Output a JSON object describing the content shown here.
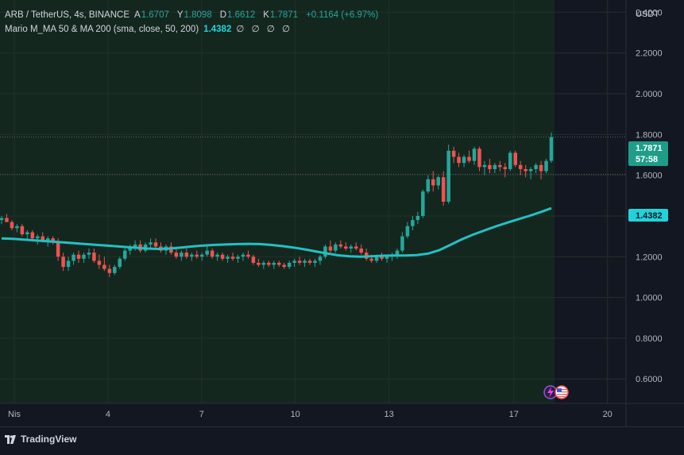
{
  "legend": {
    "symbol": "ARB / TetherUS, 4s, BINANCE",
    "open_label": "A",
    "open": "1.6707",
    "high_label": "Y",
    "high": "1.8098",
    "low_label": "D",
    "low": "1.6612",
    "close_label": "K",
    "close": "1.7871",
    "change": "+0.1164 (+6.97%)",
    "indicator_name": "Mario M_MA 50 & MA 200 (sma, close, 50, 200)",
    "indicator_value": "1.4382",
    "indicator_extra": "∅ ∅ ∅ ∅"
  },
  "axis": {
    "currency": "USDT",
    "price_badge": "1.7871",
    "countdown": "57:58",
    "ma_badge": "1.4382"
  },
  "footer": {
    "brand": "TradingView",
    "logo_icon": "tradingview-logo-icon"
  },
  "colors": {
    "up": "#26a69a",
    "down": "#ef5350",
    "ma": "#22c1c3",
    "plot_bg": "#14271f",
    "future_bg": "#131722"
  },
  "chart_data": {
    "type": "candlestick",
    "yticks": [
      "2.4000",
      "2.2000",
      "2.0000",
      "1.8000",
      "1.6000",
      "1.4000",
      "1.2000",
      "1.0000",
      "0.8000",
      "0.6000"
    ],
    "ylim": [
      0.48,
      2.46
    ],
    "xticks": [
      {
        "label": "Nis",
        "day": 1
      },
      {
        "label": "4",
        "day": 4
      },
      {
        "label": "7",
        "day": 7
      },
      {
        "label": "10",
        "day": 10
      },
      {
        "label": "13",
        "day": 13
      },
      {
        "label": "17",
        "day": 17
      },
      {
        "label": "20",
        "day": 20
      }
    ],
    "grid": true,
    "current_price": 1.7871,
    "reference_line": 1.605,
    "candles": [
      [
        1.38,
        1.4,
        1.36,
        1.39
      ],
      [
        1.39,
        1.41,
        1.37,
        1.37
      ],
      [
        1.37,
        1.38,
        1.33,
        1.34
      ],
      [
        1.34,
        1.36,
        1.32,
        1.35
      ],
      [
        1.35,
        1.36,
        1.3,
        1.31
      ],
      [
        1.31,
        1.33,
        1.28,
        1.32
      ],
      [
        1.32,
        1.33,
        1.28,
        1.29
      ],
      [
        1.29,
        1.31,
        1.26,
        1.3
      ],
      [
        1.3,
        1.32,
        1.27,
        1.28
      ],
      [
        1.28,
        1.3,
        1.25,
        1.29
      ],
      [
        1.29,
        1.3,
        1.26,
        1.27
      ],
      [
        1.27,
        1.29,
        1.18,
        1.2
      ],
      [
        1.2,
        1.22,
        1.13,
        1.15
      ],
      [
        1.15,
        1.2,
        1.13,
        1.18
      ],
      [
        1.18,
        1.22,
        1.16,
        1.21
      ],
      [
        1.21,
        1.23,
        1.17,
        1.19
      ],
      [
        1.19,
        1.22,
        1.17,
        1.21
      ],
      [
        1.21,
        1.24,
        1.19,
        1.22
      ],
      [
        1.22,
        1.24,
        1.17,
        1.18
      ],
      [
        1.18,
        1.21,
        1.14,
        1.16
      ],
      [
        1.16,
        1.2,
        1.13,
        1.14
      ],
      [
        1.14,
        1.16,
        1.1,
        1.12
      ],
      [
        1.12,
        1.16,
        1.11,
        1.15
      ],
      [
        1.15,
        1.2,
        1.14,
        1.19
      ],
      [
        1.19,
        1.24,
        1.18,
        1.23
      ],
      [
        1.23,
        1.26,
        1.21,
        1.25
      ],
      [
        1.25,
        1.28,
        1.23,
        1.26
      ],
      [
        1.26,
        1.28,
        1.22,
        1.23
      ],
      [
        1.23,
        1.27,
        1.22,
        1.26
      ],
      [
        1.26,
        1.29,
        1.24,
        1.27
      ],
      [
        1.27,
        1.29,
        1.24,
        1.25
      ],
      [
        1.25,
        1.27,
        1.22,
        1.23
      ],
      [
        1.23,
        1.26,
        1.21,
        1.25
      ],
      [
        1.25,
        1.27,
        1.21,
        1.22
      ],
      [
        1.22,
        1.24,
        1.19,
        1.2
      ],
      [
        1.2,
        1.23,
        1.18,
        1.22
      ],
      [
        1.22,
        1.24,
        1.19,
        1.2
      ],
      [
        1.2,
        1.22,
        1.18,
        1.21
      ],
      [
        1.21,
        1.23,
        1.19,
        1.2
      ],
      [
        1.2,
        1.22,
        1.18,
        1.21
      ],
      [
        1.21,
        1.25,
        1.2,
        1.23
      ],
      [
        1.23,
        1.24,
        1.19,
        1.2
      ],
      [
        1.2,
        1.22,
        1.18,
        1.21
      ],
      [
        1.21,
        1.22,
        1.18,
        1.19
      ],
      [
        1.19,
        1.21,
        1.17,
        1.2
      ],
      [
        1.2,
        1.22,
        1.18,
        1.19
      ],
      [
        1.19,
        1.21,
        1.17,
        1.2
      ],
      [
        1.2,
        1.22,
        1.18,
        1.21
      ],
      [
        1.21,
        1.23,
        1.19,
        1.2
      ],
      [
        1.2,
        1.21,
        1.16,
        1.17
      ],
      [
        1.17,
        1.19,
        1.15,
        1.16
      ],
      [
        1.16,
        1.18,
        1.14,
        1.17
      ],
      [
        1.17,
        1.18,
        1.15,
        1.16
      ],
      [
        1.16,
        1.18,
        1.14,
        1.17
      ],
      [
        1.17,
        1.18,
        1.15,
        1.16
      ],
      [
        1.16,
        1.17,
        1.14,
        1.15
      ],
      [
        1.15,
        1.18,
        1.14,
        1.17
      ],
      [
        1.17,
        1.19,
        1.15,
        1.18
      ],
      [
        1.18,
        1.2,
        1.16,
        1.17
      ],
      [
        1.17,
        1.19,
        1.15,
        1.18
      ],
      [
        1.18,
        1.19,
        1.16,
        1.17
      ],
      [
        1.17,
        1.19,
        1.15,
        1.18
      ],
      [
        1.18,
        1.21,
        1.16,
        1.2
      ],
      [
        1.2,
        1.26,
        1.19,
        1.25
      ],
      [
        1.25,
        1.28,
        1.22,
        1.23
      ],
      [
        1.23,
        1.27,
        1.22,
        1.26
      ],
      [
        1.26,
        1.28,
        1.24,
        1.25
      ],
      [
        1.25,
        1.27,
        1.23,
        1.24
      ],
      [
        1.24,
        1.26,
        1.22,
        1.25
      ],
      [
        1.25,
        1.27,
        1.23,
        1.24
      ],
      [
        1.24,
        1.26,
        1.21,
        1.22
      ],
      [
        1.22,
        1.24,
        1.18,
        1.19
      ],
      [
        1.19,
        1.21,
        1.17,
        1.18
      ],
      [
        1.18,
        1.21,
        1.17,
        1.2
      ],
      [
        1.2,
        1.22,
        1.18,
        1.19
      ],
      [
        1.19,
        1.21,
        1.17,
        1.2
      ],
      [
        1.2,
        1.22,
        1.18,
        1.21
      ],
      [
        1.21,
        1.24,
        1.19,
        1.23
      ],
      [
        1.23,
        1.32,
        1.22,
        1.3
      ],
      [
        1.3,
        1.37,
        1.29,
        1.35
      ],
      [
        1.35,
        1.4,
        1.33,
        1.38
      ],
      [
        1.38,
        1.42,
        1.36,
        1.4
      ],
      [
        1.4,
        1.53,
        1.39,
        1.52
      ],
      [
        1.52,
        1.6,
        1.51,
        1.58
      ],
      [
        1.58,
        1.62,
        1.52,
        1.55
      ],
      [
        1.55,
        1.6,
        1.53,
        1.59
      ],
      [
        1.59,
        1.62,
        1.45,
        1.47
      ],
      [
        1.47,
        1.75,
        1.46,
        1.72
      ],
      [
        1.72,
        1.74,
        1.66,
        1.69
      ],
      [
        1.69,
        1.71,
        1.64,
        1.66
      ],
      [
        1.66,
        1.7,
        1.64,
        1.69
      ],
      [
        1.69,
        1.72,
        1.66,
        1.67
      ],
      [
        1.67,
        1.74,
        1.65,
        1.73
      ],
      [
        1.73,
        1.74,
        1.62,
        1.64
      ],
      [
        1.64,
        1.67,
        1.6,
        1.65
      ],
      [
        1.65,
        1.68,
        1.61,
        1.63
      ],
      [
        1.63,
        1.66,
        1.61,
        1.65
      ],
      [
        1.65,
        1.67,
        1.62,
        1.64
      ],
      [
        1.64,
        1.66,
        1.59,
        1.63
      ],
      [
        1.63,
        1.72,
        1.62,
        1.71
      ],
      [
        1.71,
        1.72,
        1.64,
        1.65
      ],
      [
        1.65,
        1.67,
        1.6,
        1.63
      ],
      [
        1.63,
        1.65,
        1.59,
        1.62
      ],
      [
        1.62,
        1.64,
        1.58,
        1.63
      ],
      [
        1.63,
        1.66,
        1.61,
        1.65
      ],
      [
        1.65,
        1.67,
        1.58,
        1.62
      ],
      [
        1.62,
        1.68,
        1.61,
        1.67
      ],
      [
        1.6707,
        1.8098,
        1.6612,
        1.7871
      ]
    ],
    "ma_line": [
      1.29,
      1.288,
      1.284,
      1.28,
      1.276,
      1.272,
      1.268,
      1.264,
      1.26,
      1.256,
      1.252,
      1.248,
      1.244,
      1.24,
      1.238,
      1.24,
      1.245,
      1.25,
      1.255,
      1.258,
      1.26,
      1.262,
      1.263,
      1.262,
      1.258,
      1.252,
      1.245,
      1.236,
      1.226,
      1.216,
      1.207,
      1.202,
      1.2,
      1.202,
      1.205,
      1.206,
      1.206,
      1.208,
      1.215,
      1.232,
      1.258,
      1.285,
      1.308,
      1.328,
      1.348,
      1.366,
      1.383,
      1.4,
      1.418,
      1.438
    ]
  }
}
